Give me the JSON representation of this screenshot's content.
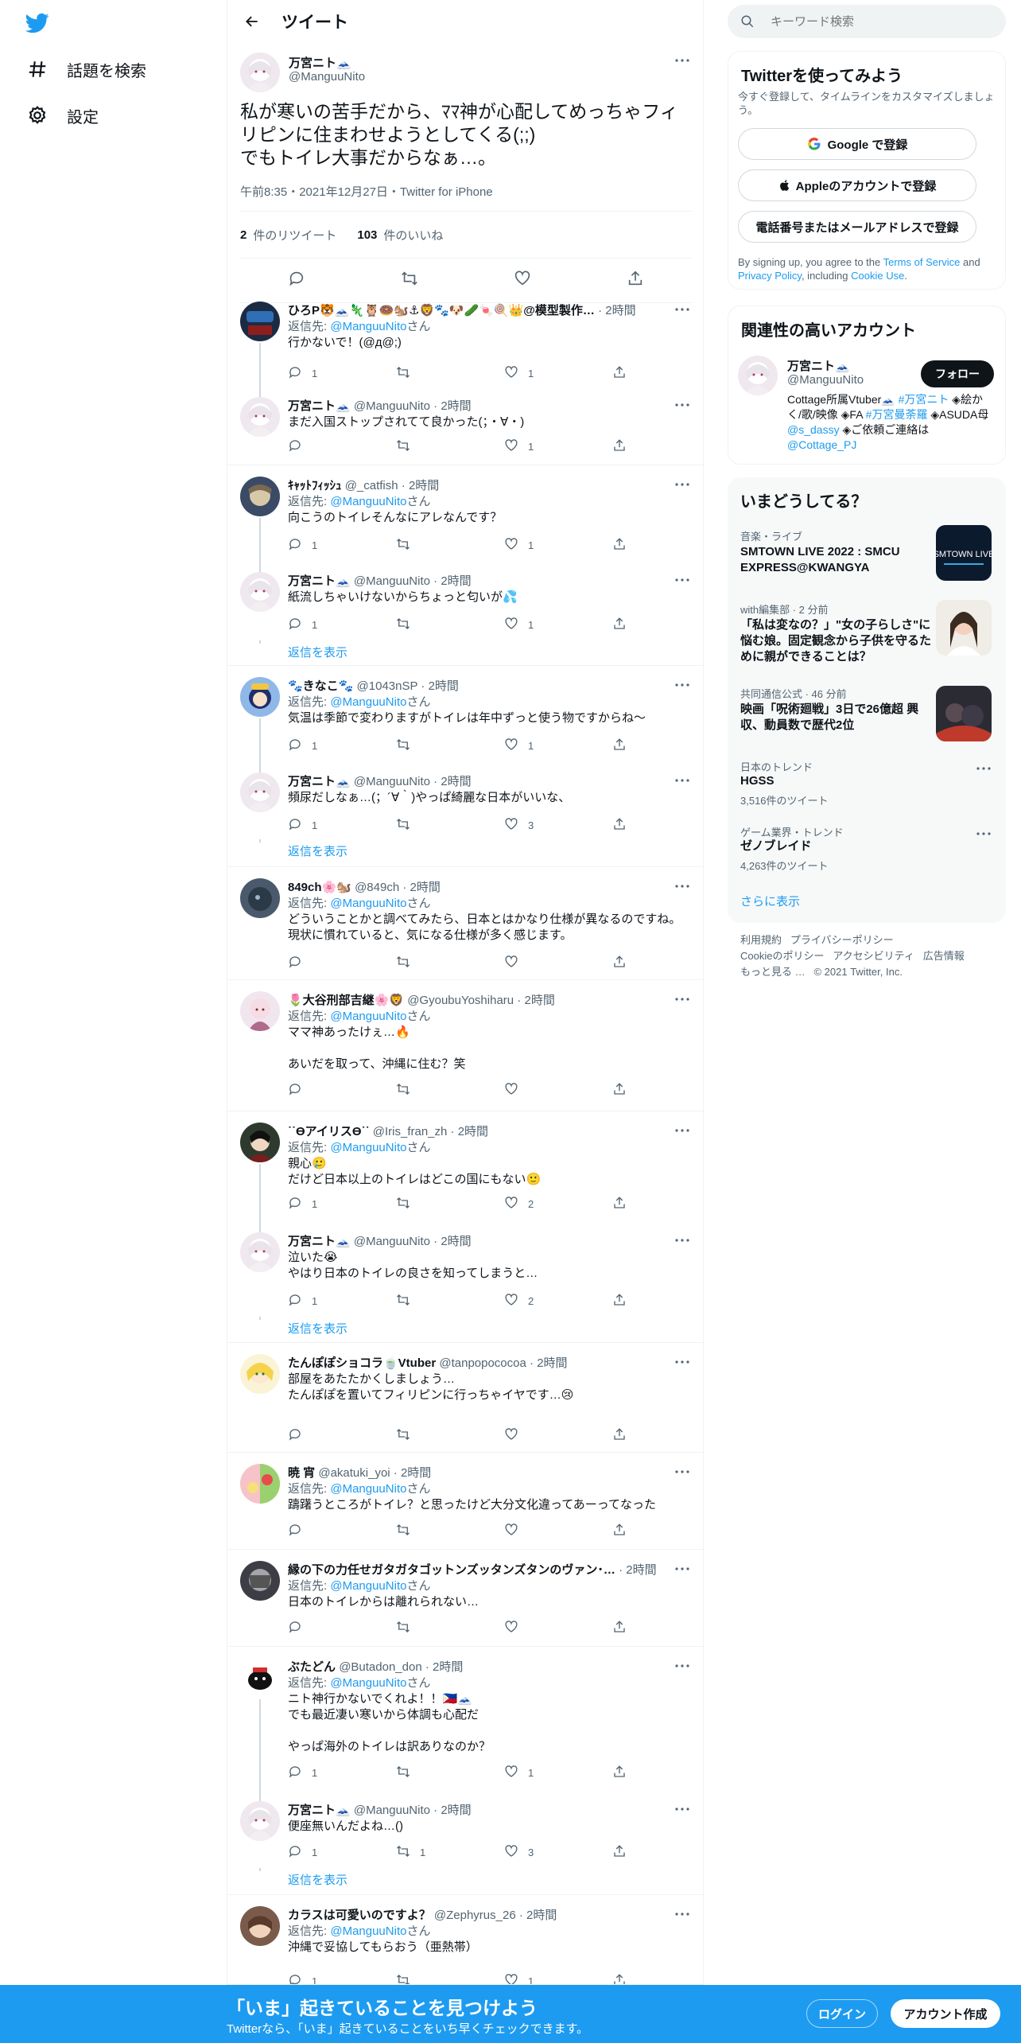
{
  "nav": {
    "explore": "話題を検索",
    "settings": "設定"
  },
  "header": {
    "title": "ツイート"
  },
  "main_tweet": {
    "name": "万宮ニト🗻",
    "handle": "@ManguuNito",
    "text": "私が寒いの苦手だから、ﾏﾏ神が心配してめっちゃフィリピンに住まわせようとしてくる(;;)\nでもトイレ大事だからなぁ…。",
    "meta": "午前8:35・2021年12月27日・Twitter for iPhone",
    "retweets": "2",
    "retweets_label": "件のリツイート",
    "likes": "103",
    "likes_label": "件のいいね"
  },
  "reply_to_label": "返信先:",
  "san": "さん",
  "show_replies": "返信を表示",
  "replies": [
    {
      "name": "ひろP🐯🗻🦎🦉🍩🐿️⚓🦁🐾🐶🥒🍬🍭👑@模型製作…",
      "handle": "",
      "time": "2時間",
      "to": "@ManguuNito",
      "text": "行かないで！(@д@;)",
      "reply": "1",
      "rt": "",
      "like": "1"
    },
    {
      "name": "万宮ニト🗻",
      "handle": "@ManguuNito",
      "time": "2時間",
      "to": "",
      "text": "まだ入国ストップされてて良かった(；・∀・)",
      "reply": "",
      "rt": "",
      "like": "1"
    },
    {
      "name": "ｷｬｯﾄﾌｨｯｼｭ",
      "handle": "@_catfish",
      "time": "2時間",
      "to": "@ManguuNito",
      "text": "向こうのトイレそんなにアレなんです？",
      "reply": "1",
      "rt": "",
      "like": "1"
    },
    {
      "name": "万宮ニト🗻",
      "handle": "@ManguuNito",
      "time": "2時間",
      "to": "",
      "text": "紙流しちゃいけないからちょっと匂いが💦",
      "reply": "1",
      "rt": "",
      "like": "1"
    },
    {
      "name": "🐾きなこ🐾",
      "handle": "@1043nSP",
      "time": "2時間",
      "to": "@ManguuNito",
      "text": "気温は季節で変わりますがトイレは年中ずっと使う物ですからね〜",
      "reply": "1",
      "rt": "",
      "like": "1"
    },
    {
      "name": "万宮ニト🗻",
      "handle": "@ManguuNito",
      "time": "2時間",
      "to": "",
      "text": "頻尿だしなぁ…(；´∀｀)やっぱ綺麗な日本がいいな、",
      "reply": "1",
      "rt": "",
      "like": "3"
    },
    {
      "name": "849ch🌸🐿️",
      "handle": "@849ch",
      "time": "2時間",
      "to": "@ManguuNito",
      "text": "どういうことかと調べてみたら、日本とはかなり仕様が異なるのですね。\n現状に慣れていると、気になる仕様が多く感じます。",
      "reply": "",
      "rt": "",
      "like": ""
    },
    {
      "name": "🌷大谷刑部吉継🌸🦁",
      "handle": "@GyoubuYoshiharu",
      "time": "2時間",
      "to": "@ManguuNito",
      "text": "ママ神あったけぇ…🔥\n\nあいだを取って、沖縄に住む？笑",
      "reply": "",
      "rt": "",
      "like": ""
    },
    {
      "name": "˙˙ϴアイリスϴ˙˙",
      "handle": "@Iris_fran_zh",
      "time": "2時間",
      "to": "@ManguuNito",
      "text": "親心🥲\nだけど日本以上のトイレはどこの国にもない🙂",
      "reply": "1",
      "rt": "",
      "like": "2"
    },
    {
      "name": "万宮ニト🗻",
      "handle": "@ManguuNito",
      "time": "2時間",
      "to": "",
      "text": "泣いた😭\nやはり日本のトイレの良さを知ってしまうと…",
      "reply": "1",
      "rt": "",
      "like": "2"
    },
    {
      "name": "たんぽぽショコラ🍵Vtuber",
      "handle": "@tanpopococoa",
      "time": "2時間",
      "to": "",
      "text": "部屋をあたたかくしましょう…\nたんぽぽを置いてフィリピンに行っちゃイヤです…😢",
      "reply": "",
      "rt": "",
      "like": ""
    },
    {
      "name": "暁 宵",
      "handle": "@akatuki_yoi",
      "time": "2時間",
      "to": "@ManguuNito",
      "text": "躊躇うところがトイレ？と思ったけど大分文化違ってあーってなった",
      "reply": "",
      "rt": "",
      "like": ""
    },
    {
      "name": "縁の下の力任せガタガタゴットンズッタンズタンのヴァン･…",
      "handle": "",
      "time": "2時間",
      "to": "@ManguuNito",
      "text": "日本のトイレからは離れられない…",
      "reply": "",
      "rt": "",
      "like": ""
    },
    {
      "name": "ぶたどん",
      "handle": "@Butadon_don",
      "time": "2時間",
      "to": "@ManguuNito",
      "text": "ニト神行かないでくれよ！！🇵🇭🗻\nでも最近凄い寒いから体調も心配だ\n\nやっぱ海外のトイレは訳ありなのか？",
      "reply": "1",
      "rt": "",
      "like": "1"
    },
    {
      "name": "万宮ニト🗻",
      "handle": "@ManguuNito",
      "time": "2時間",
      "to": "",
      "text": "便座無いんだよね…()",
      "reply": "1",
      "rt": "1",
      "like": "3"
    },
    {
      "name": "カラスは可愛いのですよ？",
      "handle": "@Zephyrus_26",
      "time": "2時間",
      "to": "@ManguuNito",
      "text": "沖縄で妥協してもらおう（亜熱帯）",
      "reply": "1",
      "rt": "",
      "like": "1"
    }
  ],
  "right": {
    "search_placeholder": "キーワード検索",
    "signup": {
      "title": "Twitterを使ってみよう",
      "desc": "今すぐ登録して、タイムラインをカスタマイズしましょう。",
      "google": "Google で登録",
      "apple": "Appleのアカウントで登録",
      "phone": "電話番号またはメールアドレスで登録",
      "terms_pre": "By signing up, you agree to the ",
      "terms": "Terms of Service",
      "and": " and ",
      "privacy": "Privacy Policy",
      "including": ", including ",
      "cookie": "Cookie Use",
      "dot": "."
    },
    "relevant": {
      "title": "関連性の高いアカウント",
      "name": "万宮ニト🗻",
      "handle": "@ManguuNito",
      "follow": "フォロー",
      "bio_1": "Cottage所属Vtuber🗻 ",
      "bio_tag1": "#万宮ニト",
      "bio_2": " ◈絵かく/歌/映像 ◈FA ",
      "bio_tag2": "#万宮曼荼羅",
      "bio_3": " ◈ASUDA母 ",
      "bio_link1": "@s_dassy",
      "bio_4": " ◈ご依頼ご連絡は ",
      "bio_link2": "@Cottage_PJ"
    },
    "trends": {
      "title": "いまどうしてる？",
      "items": [
        {
          "cat": "音楽・ライブ",
          "title": "SMTOWN LIVE 2022 : SMCU EXPRESS@KWANGYA"
        },
        {
          "cat": "with編集部 · 2 分前",
          "title": "「私は変なの？」\"女の子らしさ\"に悩む娘。固定観念から子供を守るために親ができることは？"
        },
        {
          "cat": "共同通信公式 · 46 分前",
          "title": "映画「呪術廻戦」3日で26億超 興収、動員数で歴代2位"
        },
        {
          "cat": "日本のトレンド",
          "title": "HGSS",
          "sub": "3,516件のツイート"
        },
        {
          "cat": "ゲーム業界・トレンド",
          "title": "ゼノブレイド",
          "sub": "4,263件のツイート"
        }
      ],
      "more": "さらに表示"
    },
    "footer": {
      "l1": "利用規約",
      "l2": "プライバシーポリシー",
      "l3": "Cookieのポリシー",
      "l4": "アクセシビリティ",
      "l5": "広告情報",
      "l6": "もっと見る …",
      "copy": "© 2021 Twitter, Inc."
    }
  },
  "bottom_bar": {
    "title": "「いま」起きていることを見つけよう",
    "sub": "Twitterなら、「いま」起きていることをいち早くチェックできます。",
    "login": "ログイン",
    "signup": "アカウント作成"
  },
  "colors": {
    "accent": "#1d9bf0",
    "text": "#0f1419",
    "secondary": "#536471"
  }
}
